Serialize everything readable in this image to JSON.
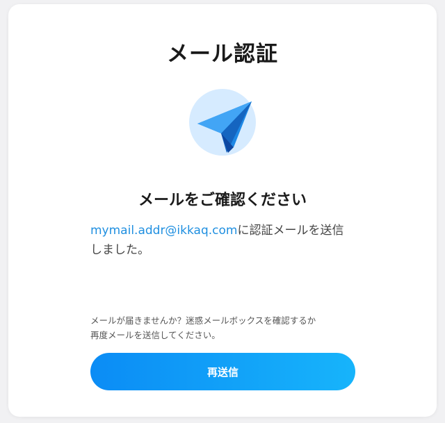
{
  "page": {
    "title": "メール認証",
    "heading": "メールをご確認ください",
    "icon": "paper-plane-icon",
    "message": {
      "email": "mymail.addr@ikkaq.com",
      "text": "に認証メールを送信しました。"
    },
    "hint": {
      "line1": "メールが届きませんか？迷惑メールボックスを確認するか",
      "line2": "再度メールを送信してください。"
    },
    "resend_label": "再送信"
  },
  "colors": {
    "accent": "#1f8fe0",
    "button_start": "#0b8cf5",
    "button_end": "#17b4fb",
    "icon_circle": "#d6ebff",
    "icon_plane": "#1e88e5"
  }
}
